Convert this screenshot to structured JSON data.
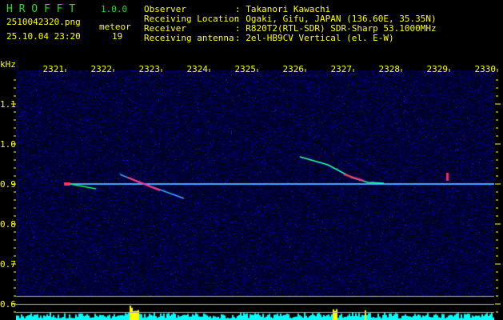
{
  "app": {
    "name": "H R O F F T",
    "version": "1.0.0"
  },
  "file": {
    "name": "2510042320.png",
    "datetime": "25.10.04 23:20"
  },
  "meteor": {
    "label": "meteor",
    "count": "19"
  },
  "info": [
    {
      "label": "Observer",
      "value": ": Takanori Kawachi"
    },
    {
      "label": "Receiving Location",
      "value": ": Ogaki, Gifu, JAPAN (136.60E, 35.35N)"
    },
    {
      "label": "Receiver",
      "value": ": R820T2(RTL-SDR) SDR-Sharp 53.1000MHz"
    },
    {
      "label": "Receiving antenna",
      "value": ": 2el-HB9CV Vertical (el. E-W)"
    }
  ],
  "axis": {
    "unit": "kHz",
    "x_ticks": [
      "2321",
      "2322",
      "2323",
      "2324",
      "2325",
      "2326",
      "2327",
      "2328",
      "2329",
      "2330"
    ],
    "y_ticks": [
      "1.1",
      "1.0",
      "0.9",
      "0.8",
      "0.7",
      "0.6"
    ]
  },
  "colors": {
    "text": "#ffff00",
    "title": "#22dd22",
    "noise": "#1a1a8c",
    "carrier": "#44aaff",
    "hist_base": "#00ffff",
    "hist_meteor": "#ffff00",
    "guide": "#aaaaaa"
  }
}
